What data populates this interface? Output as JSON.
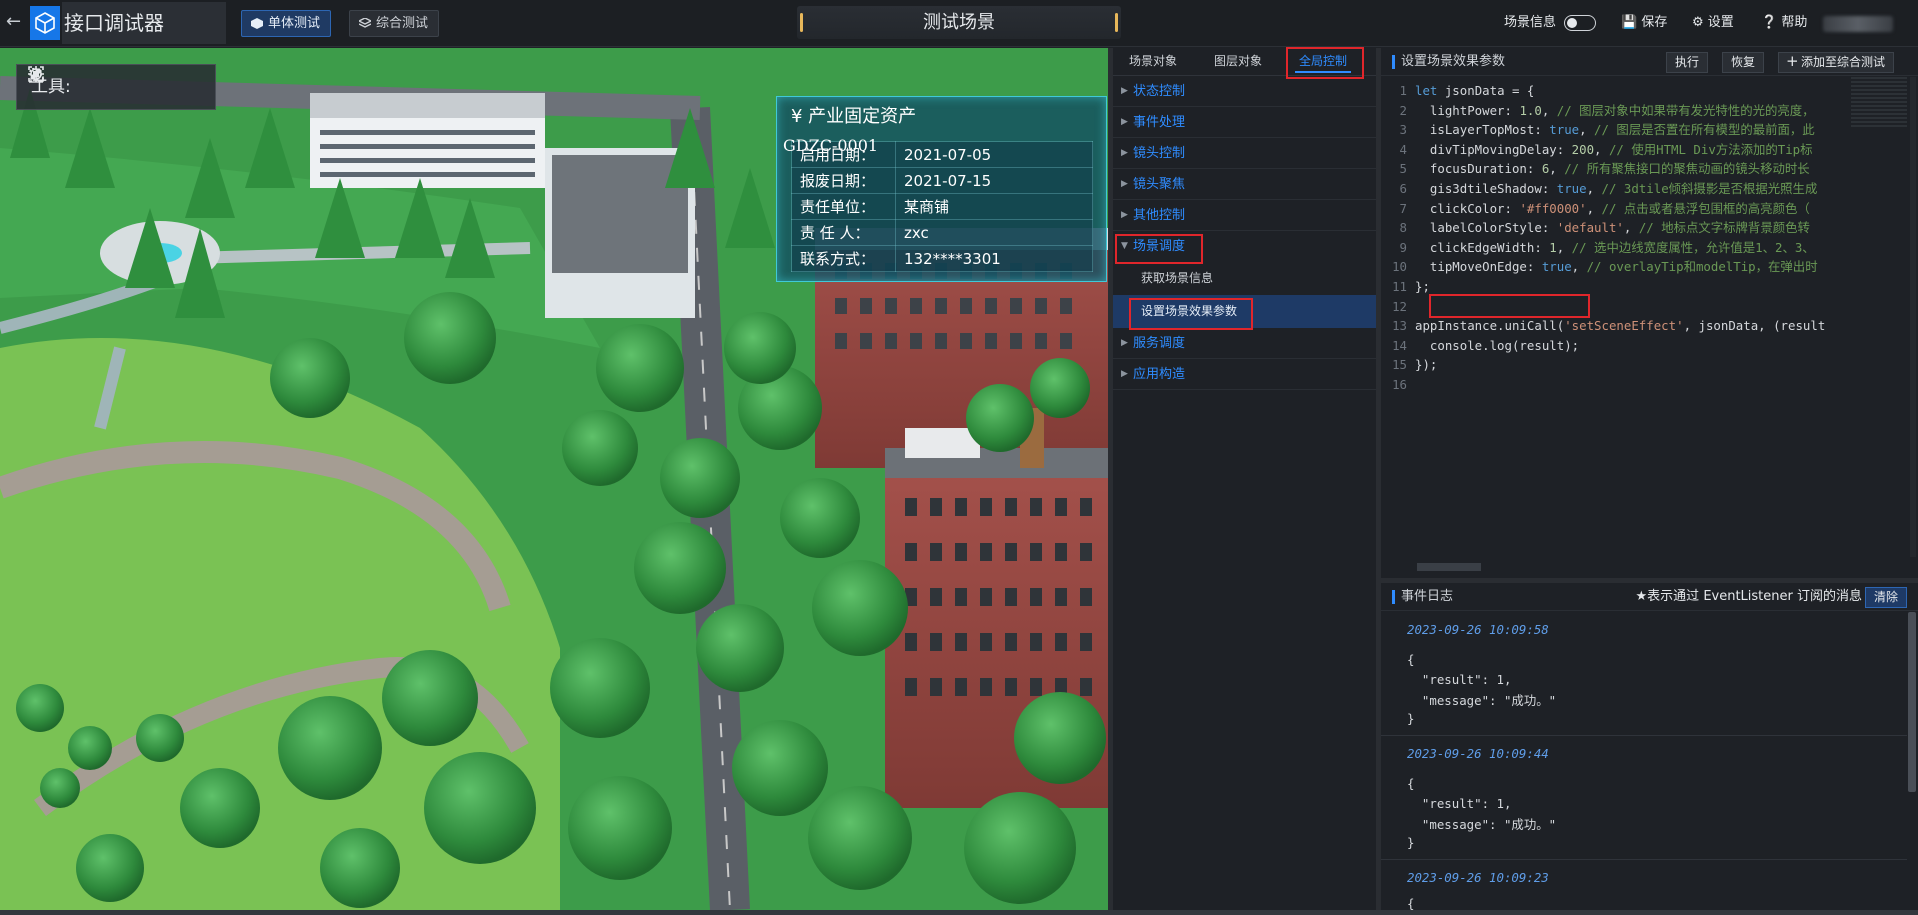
{
  "header": {
    "app_title": "接口调试器",
    "btn_single": "单体测试",
    "btn_combined": "综合测试",
    "scene_title": "测试场景",
    "scene_info_label": "场景信息",
    "save_label": "保存",
    "settings_label": "设置",
    "help_label": "帮助"
  },
  "scene": {
    "toolbox_label": "工具:",
    "info_card": {
      "title": "¥ 产业固定资产",
      "code": "GDZC-0001",
      "rows": [
        {
          "k": "启用日期：",
          "v": "2021-07-05"
        },
        {
          "k": "报废日期：",
          "v": "2021-07-15"
        },
        {
          "k": "责任单位：",
          "v": "某商铺"
        },
        {
          "k": "责 任 人：",
          "v": "zxc"
        },
        {
          "k": "联系方式：",
          "v": "132****3301"
        }
      ]
    }
  },
  "middle": {
    "tabs": [
      "场景对象",
      "图层对象",
      "全局控制"
    ],
    "active_tab": "全局控制",
    "menu": [
      {
        "label": "状态控制",
        "expanded": false
      },
      {
        "label": "事件处理",
        "expanded": false
      },
      {
        "label": "镜头控制",
        "expanded": false
      },
      {
        "label": "镜头聚焦",
        "expanded": false
      },
      {
        "label": "其他控制",
        "expanded": false
      },
      {
        "label": "场景调度",
        "expanded": true
      }
    ],
    "sub_items": [
      "获取场景信息",
      "设置场景效果参数"
    ],
    "menu_after": [
      "服务调度",
      "应用构造"
    ]
  },
  "code": {
    "title": "设置场景效果参数",
    "btn_run": "执行",
    "btn_restore": "恢复",
    "btn_add": "添加至综合测试",
    "lines": [
      "let jsonData = {",
      "  lightPower: 1.0, // 图层对象中如果带有发光特性的光的亮度，",
      "  isLayerTopMost: true, // 图层是否置在所有模型的最前面，此",
      "  divTipMovingDelay: 200, // 使用HTML Div方法添加的Tip标",
      "  focusDuration: 6, // 所有聚焦接口的聚焦动画的镜头移动时长",
      "  gis3dtileShadow: true, // 3dtile倾斜摄影是否根据光照生成",
      "  clickColor: '#ff0000', // 点击或者悬浮包围框的高亮颜色（",
      "  labelColorStyle: 'default', // 地标点文字标牌背景颜色转",
      "  clickEdgeWidth: 1, // 选中边线宽度属性，允许值是1、2、3、",
      "  tipMoveOnEdge: true, // overlayTip和modelTip，在弹出时",
      "};",
      "",
      "appInstance.uniCall('setSceneEffect', jsonData, (result",
      "  console.log(result);",
      "});",
      ""
    ]
  },
  "log": {
    "title": "事件日志",
    "note": "★表示通过 EventListener 订阅的消息",
    "clear_label": "清除",
    "entries": [
      {
        "ts": "2023-09-26 10:09:58",
        "l1": "{",
        "l2": "  \"result\": 1,",
        "l3": "  \"message\": \"成功。\"",
        "l4": "}"
      },
      {
        "ts": "2023-09-26 10:09:44",
        "l1": "{",
        "l2": "  \"result\": 1,",
        "l3": "  \"message\": \"成功。\"",
        "l4": "}"
      },
      {
        "ts": "2023-09-26 10:09:23",
        "l1": "{",
        "l2": "",
        "l3": "",
        "l4": ""
      }
    ]
  },
  "colors": {
    "accent": "#2f8cff",
    "highlight_box": "#e0262b",
    "info_card_border": "#3fc9d8"
  }
}
